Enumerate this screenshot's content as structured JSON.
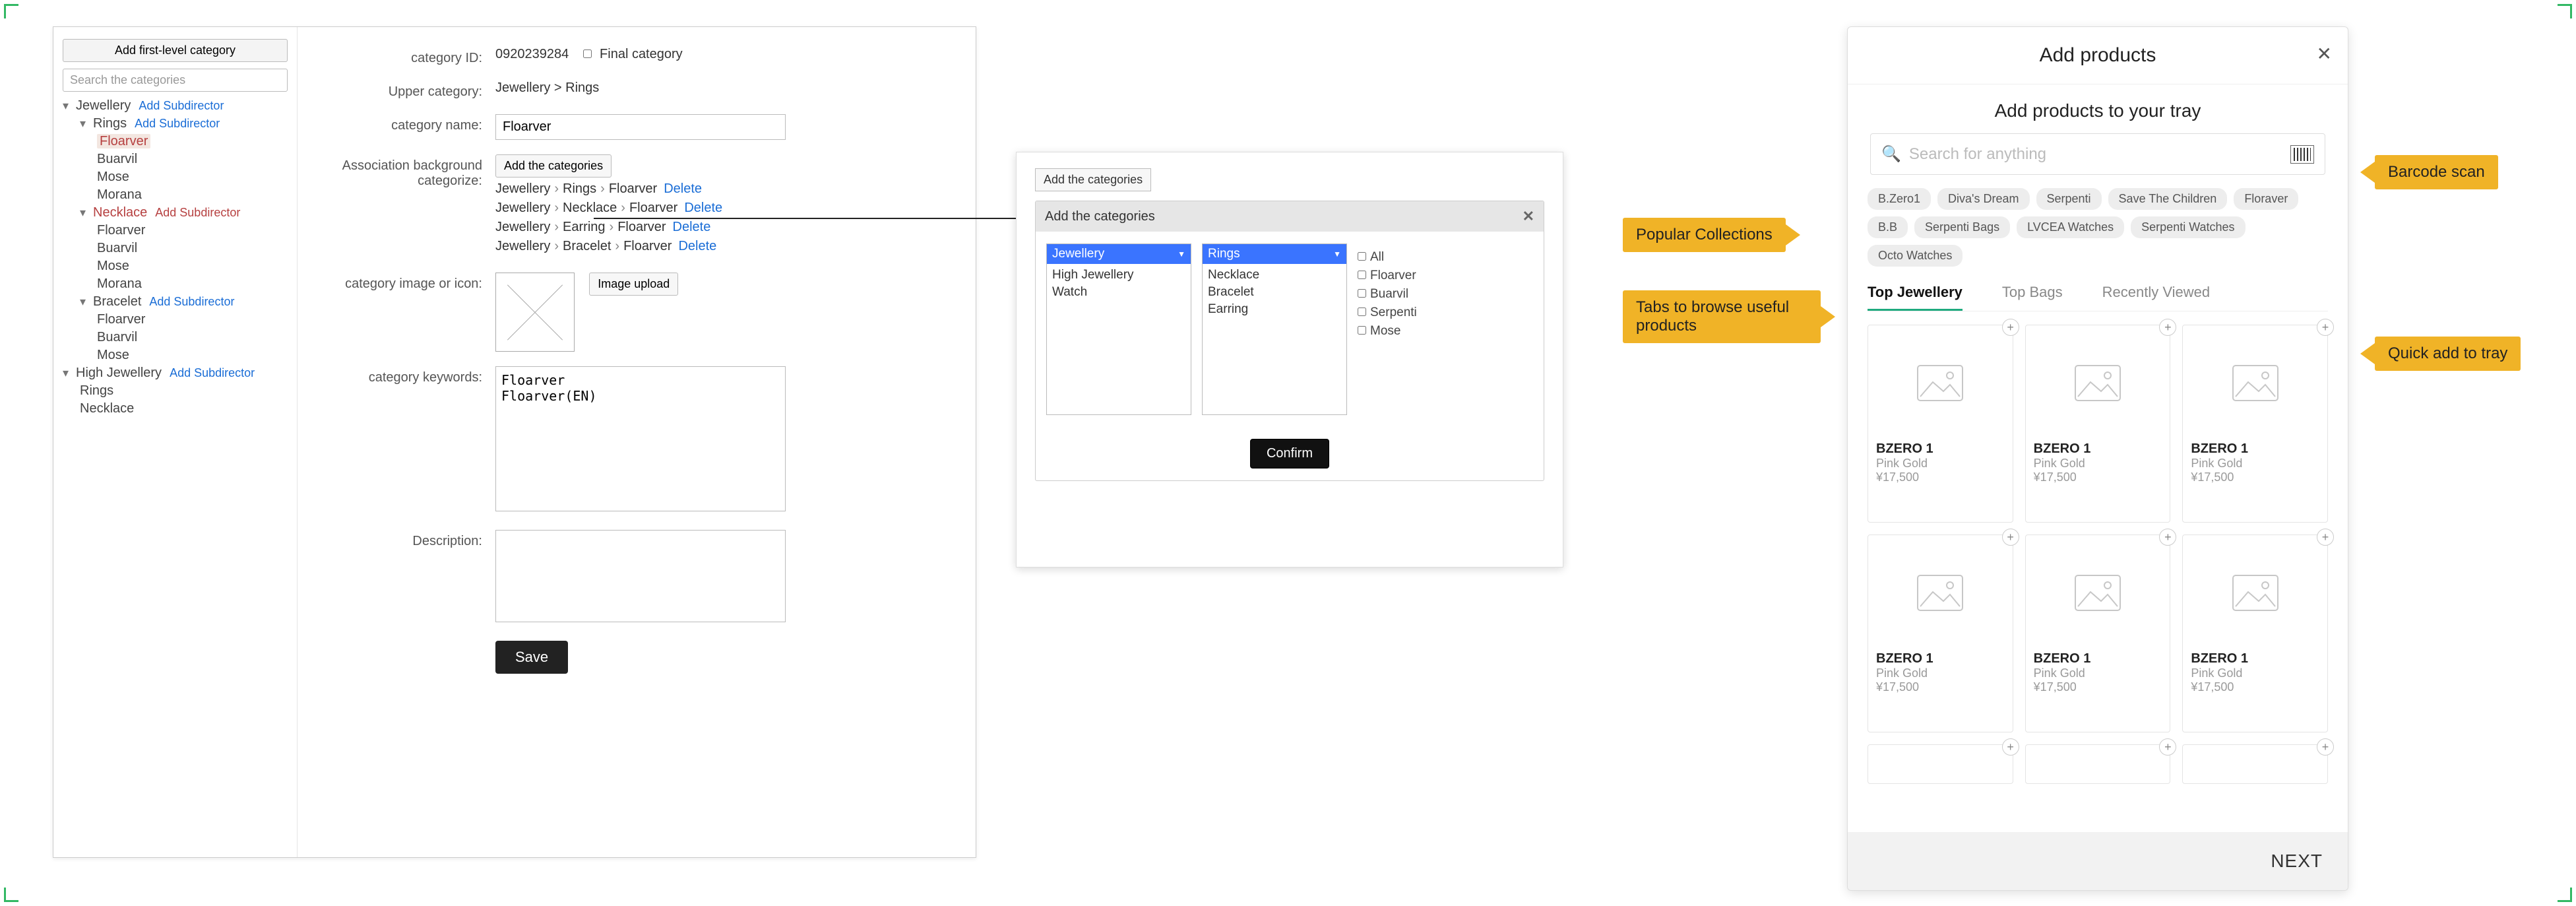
{
  "left": {
    "addFirstLevel": "Add  first-level category",
    "searchPlaceholder": "Search the categories",
    "addSub": "Add Subdirector",
    "tree": {
      "jewellery": "Jewellery",
      "rings": "Rings",
      "floarver": "Floarver",
      "buarvil": "Buarvil",
      "mose": "Mose",
      "morana": "Morana",
      "necklace": "Necklace",
      "bracelet": "Bracelet",
      "highJewellery": "High Jewellery"
    },
    "form": {
      "catIdLabel": "category ID:",
      "catIdValue": "0920239284",
      "finalCat": "Final category",
      "upperCatLabel": "Upper category:",
      "upperCatValue": "Jewellery > Rings",
      "catNameLabel": "category name:",
      "catNameValue": "Floarver",
      "assocLabel": "Association background categorize:",
      "addCatsBtn": "Add the categories",
      "delete": "Delete",
      "assocRows": [
        [
          "Jewellery",
          "Rings",
          "Floarver"
        ],
        [
          "Jewellery",
          "Necklace",
          "Floarver"
        ],
        [
          "Jewellery",
          "Earring",
          "Floarver"
        ],
        [
          "Jewellery",
          "Bracelet",
          "Floarver"
        ]
      ],
      "catImageLabel": "category image or icon:",
      "imageUpload": "Image upload",
      "keywordsLabel": "category keywords:",
      "keywordsValue": "Floarver\nFloarver(EN)",
      "descLabel": "Description:",
      "save": "Save"
    }
  },
  "dialog": {
    "addBtn": "Add the categories",
    "title": "Add the categories",
    "col1": {
      "head": "Jewellery",
      "items": [
        "High Jewellery",
        "Watch"
      ]
    },
    "col2": {
      "head": "Rings",
      "items": [
        "Necklace",
        "Bracelet",
        "Earring"
      ]
    },
    "checks": [
      "All",
      "Floarver",
      "Buarvil",
      "Serpenti",
      "Mose"
    ],
    "confirm": "Confirm"
  },
  "mobile": {
    "title": "Add products",
    "subtitle": "Add products to your tray",
    "searchPlaceholder": "Search for anything",
    "chips": [
      "B.Zero1",
      "Diva's Dream",
      "Serpenti",
      "Save The Children",
      "Floraver",
      "B.B",
      "Serpenti Bags",
      "LVCEA Watches",
      "Serpenti Watches",
      "Octo Watches"
    ],
    "tabs": [
      "Top Jewellery",
      "Top Bags",
      "Recently Viewed"
    ],
    "activeTab": 0,
    "product": {
      "name": "BZERO 1",
      "material": "Pink Gold",
      "price": "¥17,500"
    },
    "next": "NEXT"
  },
  "callouts": {
    "popular": "Popular Collections",
    "tabsBrowse": "Tabs to browse useful products",
    "barcode": "Barcode scan",
    "quickAdd": "Quick add to tray"
  }
}
